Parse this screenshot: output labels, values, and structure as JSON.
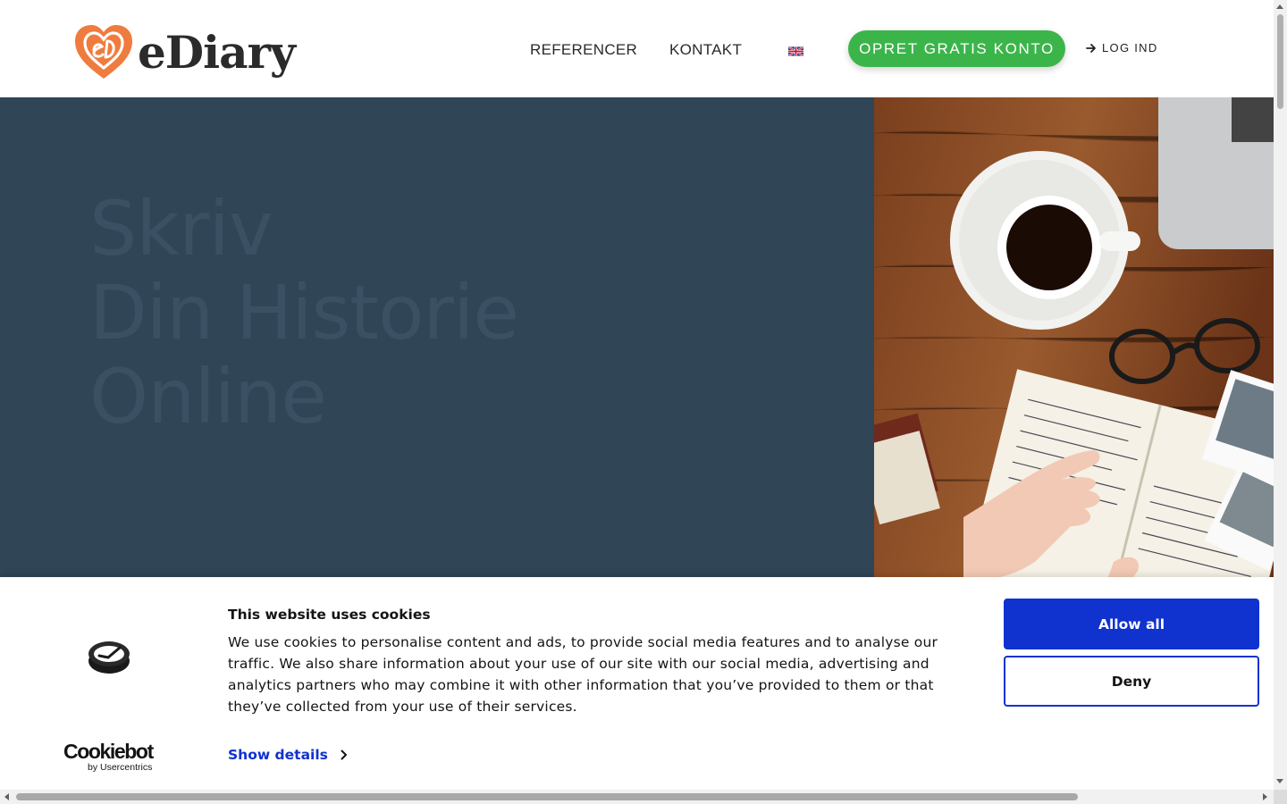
{
  "header": {
    "logo_text": "eDiary",
    "nav": [
      "REFERENCER",
      "KONTAKT"
    ],
    "language_flag": "uk-flag-icon",
    "cta_label": "OPRET GRATIS KONTO",
    "login_label": "LOG IND"
  },
  "hero": {
    "title_lines": [
      "Skriv",
      "Din Historie",
      "Online"
    ]
  },
  "cookie_banner": {
    "title": "This website uses cookies",
    "body": "We use cookies to personalise content and ads, to provide social media features and to analyse our traffic. We also share information about your use of our site with our social media, advertising and analytics partners who may combine it with other information that you’ve provided to them or that they’ve collected from your use of their services.",
    "show_details": "Show details",
    "allow_all": "Allow all",
    "deny": "Deny",
    "brand_name": "Cookiebot",
    "brand_sub": "by Usercentrics"
  },
  "colors": {
    "brand_orange": "#f07b3f",
    "cta_green": "#3bb54a",
    "hero_bg": "#304556",
    "cookie_blue": "#1032cf"
  }
}
